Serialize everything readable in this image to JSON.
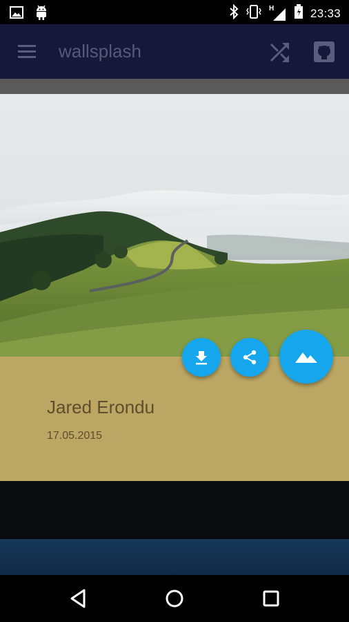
{
  "status_bar": {
    "time": "23:33",
    "network_label": "H",
    "icons": [
      "image-icon",
      "android-icon",
      "bluetooth-icon",
      "vibrate-icon",
      "signal-icon",
      "battery-icon"
    ]
  },
  "app_bar": {
    "title": "wallsplash",
    "icons": [
      "menu-icon",
      "shuffle-icon",
      "github-icon"
    ],
    "color": "#15183a"
  },
  "wallpaper": {
    "author": "Jared Erondu",
    "date": "17.05.2015",
    "panel_color": "#bca663"
  },
  "actions": {
    "icons": [
      "download-icon",
      "share-icon",
      "set-wallpaper-icon"
    ],
    "accent": "#16a6ee"
  },
  "nav_bar": {
    "icons": [
      "back-icon",
      "home-icon",
      "recents-icon"
    ]
  }
}
